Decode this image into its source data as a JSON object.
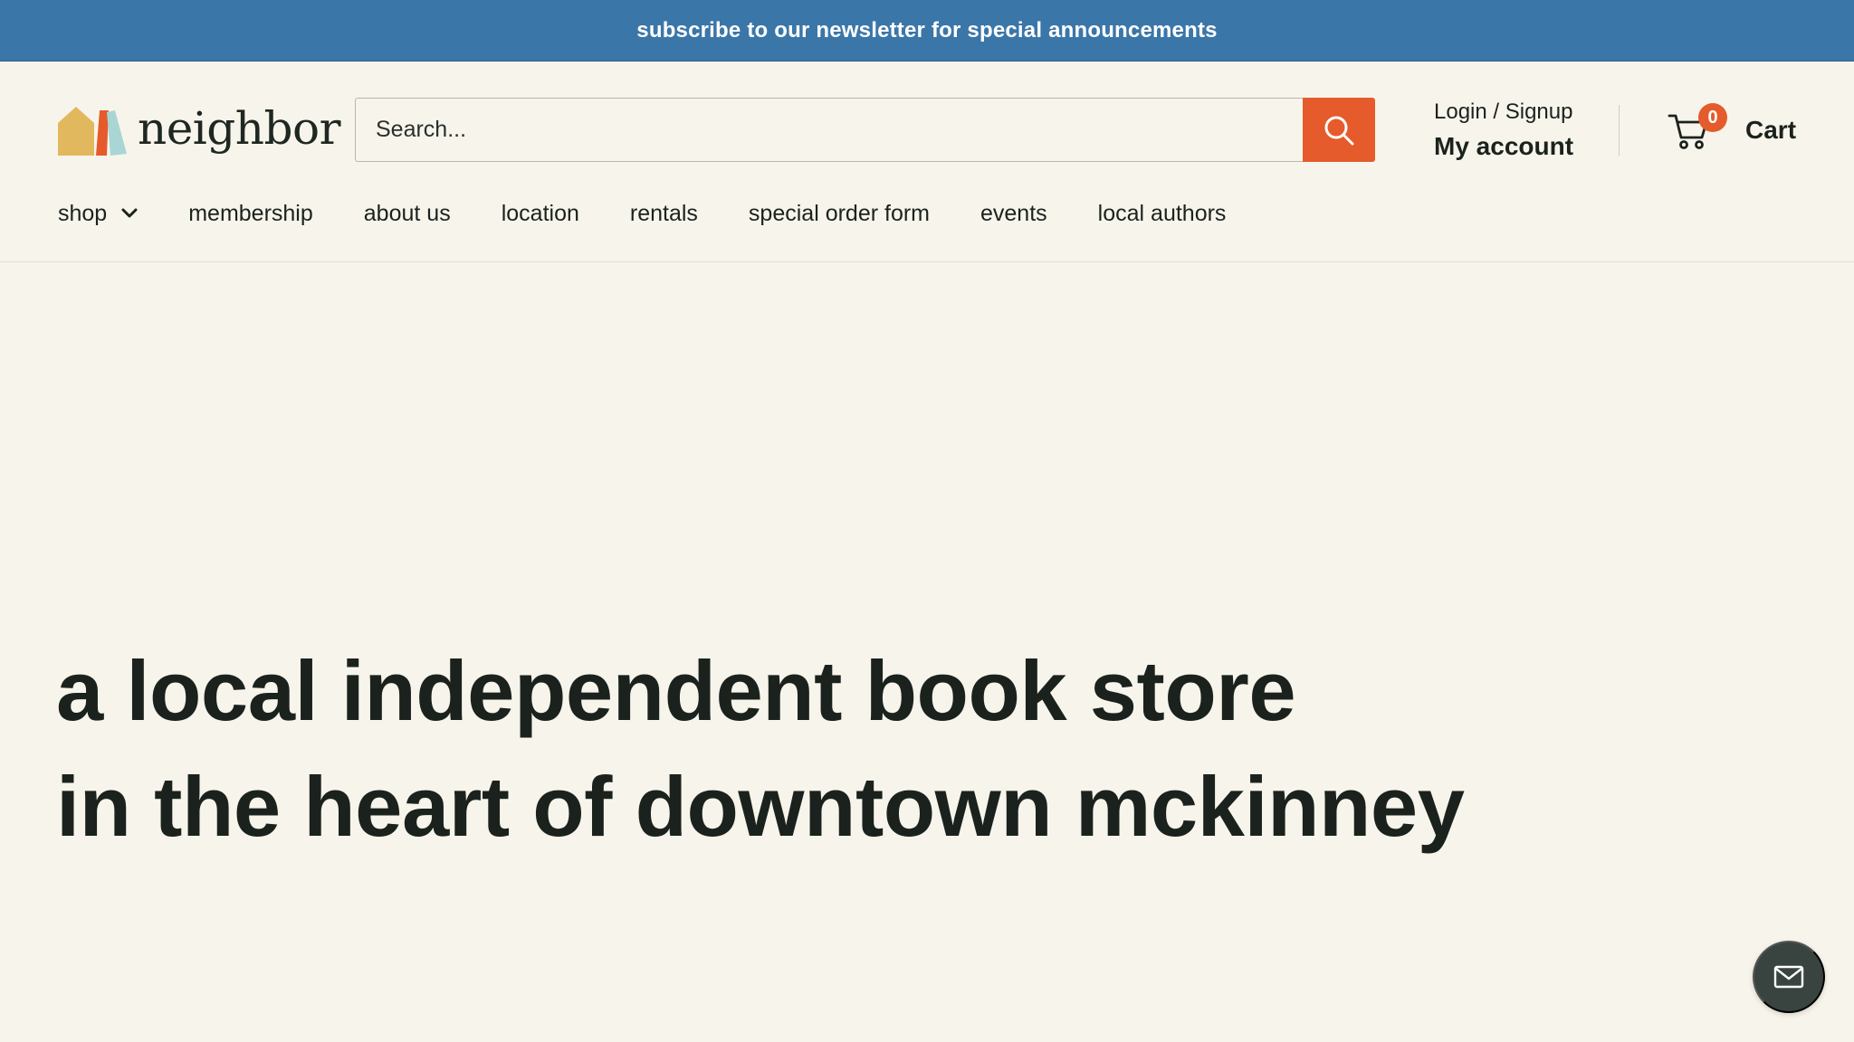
{
  "announcement": {
    "text": "subscribe to our newsletter for special announcements"
  },
  "header": {
    "logo_text": "neighbor",
    "search": {
      "placeholder": "Search...",
      "value": ""
    },
    "account": {
      "login_label": "Login / Signup",
      "my_account_label": "My account"
    },
    "cart": {
      "label": "Cart",
      "count": "0"
    }
  },
  "nav": {
    "items": [
      {
        "label": "shop",
        "has_dropdown": true
      },
      {
        "label": "membership"
      },
      {
        "label": "about us"
      },
      {
        "label": "location"
      },
      {
        "label": "rentals"
      },
      {
        "label": "special order form"
      },
      {
        "label": "events"
      },
      {
        "label": "local authors"
      }
    ]
  },
  "hero": {
    "line1": "a local independent book store",
    "line2": "in the heart of downtown mckinney"
  },
  "colors": {
    "announcement_bg": "#3b76a8",
    "accent": "#e55b2b",
    "page_bg": "#f7f5eb",
    "text": "#1b221e",
    "chat_bg": "#394340"
  },
  "icons": {
    "search": "search-icon",
    "cart": "cart-icon",
    "chevron": "chevron-down-icon",
    "chat": "mail-icon"
  }
}
